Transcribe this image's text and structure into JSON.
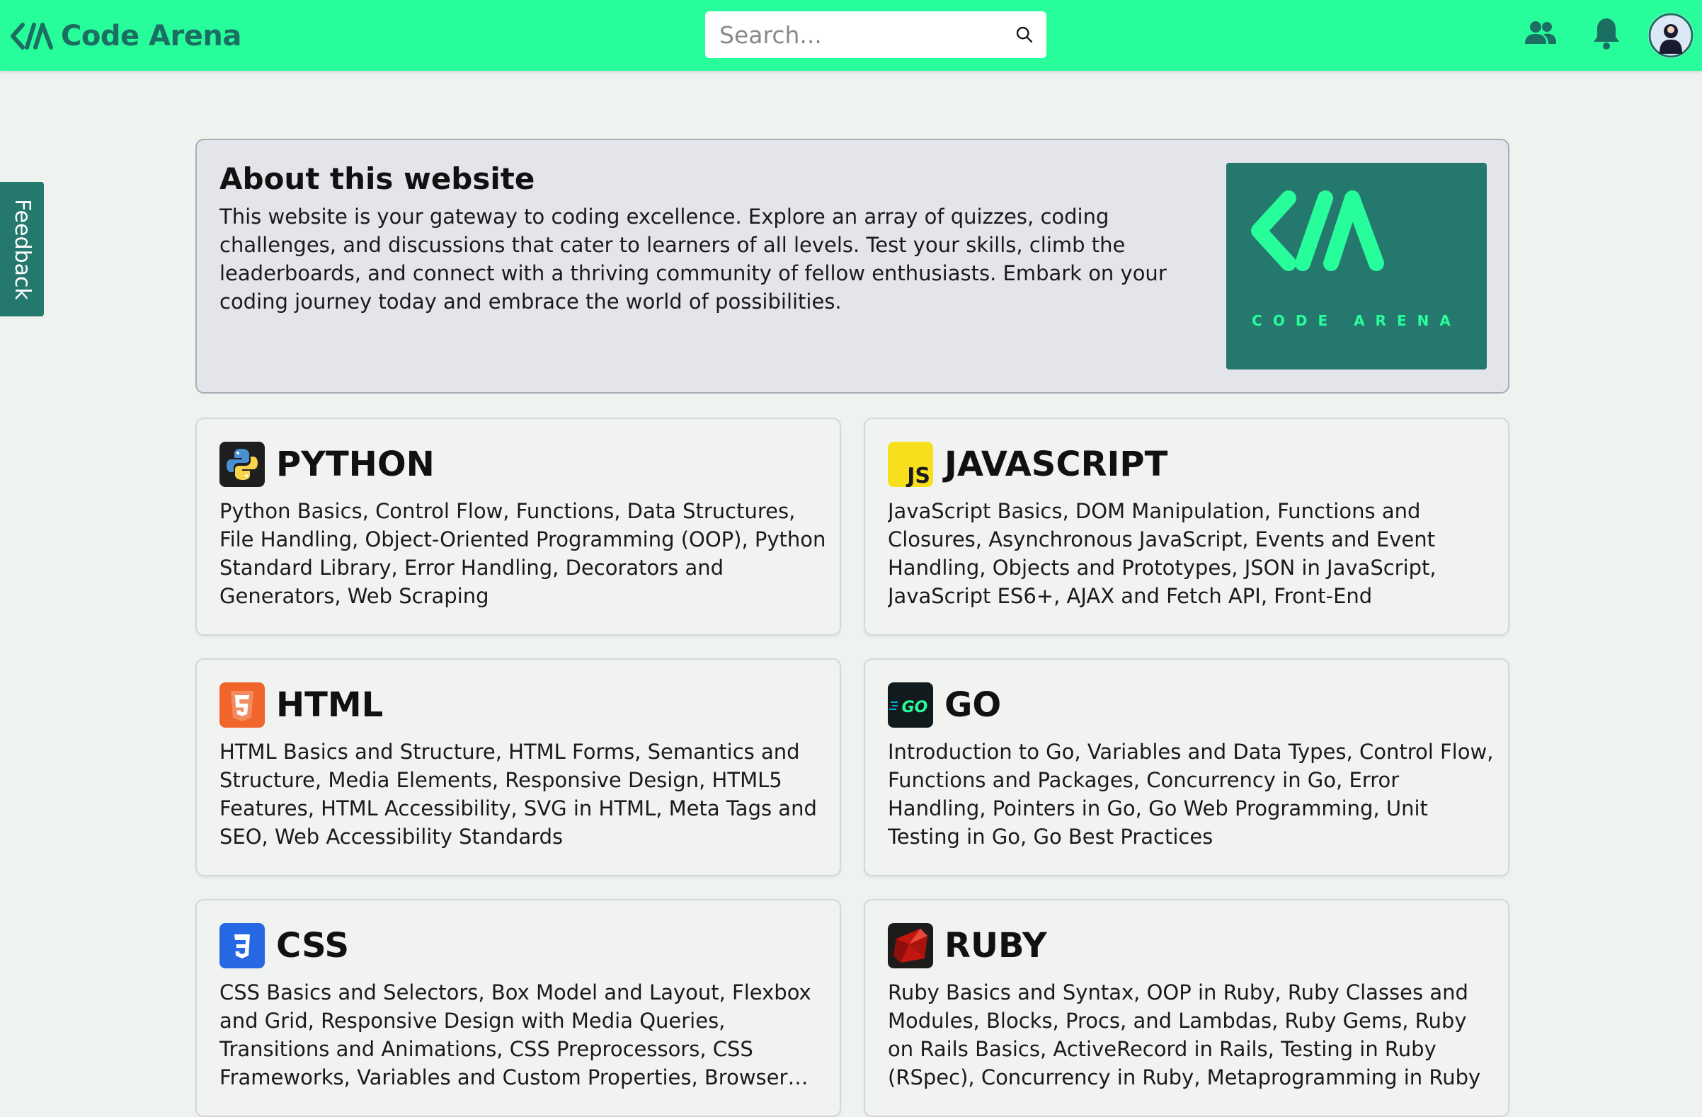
{
  "header": {
    "brand_name": "Code Arena",
    "search_placeholder": "Search..."
  },
  "feedback": {
    "label": "Feedback"
  },
  "about": {
    "title": "About this website",
    "text": "This website is your gateway to coding excellence. Explore an array of quizzes, coding challenges, and discussions that cater to learners of all levels. Test your skills, climb the leaderboards, and connect with a thriving community of fellow enthusiasts. Embark on your coding journey today and embrace the world of possibilities.",
    "logo_caption": "CODE ARENA"
  },
  "cards": [
    {
      "title": "PYTHON",
      "icon": "python-icon",
      "text": "Python Basics, Control Flow, Functions, Data Structures, File Handling, Object-Oriented Programming (OOP), Python Standard Library, Error Handling, Decorators and Generators, Web Scraping"
    },
    {
      "title": "JAVASCRIPT",
      "icon": "javascript-icon",
      "icon_text": "JS",
      "text": "JavaScript Basics, DOM Manipulation, Functions and Closures, Asynchronous JavaScript, Events and Event Handling, Objects and Prototypes, JSON in JavaScript, JavaScript ES6+, AJAX and Fetch API, Front-End Frameworks"
    },
    {
      "title": "HTML",
      "icon": "html5-icon",
      "text": "HTML Basics and Structure, HTML Forms, Semantics and Structure, Media Elements, Responsive Design, HTML5 Features, HTML Accessibility, SVG in HTML, Meta Tags and SEO, Web Accessibility Standards"
    },
    {
      "title": "GO",
      "icon": "go-icon",
      "icon_text": "GO",
      "text": "Introduction to Go, Variables and Data Types, Control Flow, Functions and Packages, Concurrency in Go, Error Handling, Pointers in Go, Go Web Programming, Unit Testing in Go, Go Best Practices"
    },
    {
      "title": "CSS",
      "icon": "css3-icon",
      "text": "CSS Basics and Selectors, Box Model and Layout, Flexbox and Grid, Responsive Design with Media Queries, Transitions and Animations, CSS Preprocessors, CSS Frameworks, Variables and Custom Properties, Browser Dev Tools, CSS..."
    },
    {
      "title": "RUBY",
      "icon": "ruby-icon",
      "text": "Ruby Basics and Syntax, OOP in Ruby, Ruby Classes and Modules, Blocks, Procs, and Lambdas, Ruby Gems, Ruby on Rails Basics, ActiveRecord in Rails, Testing in Ruby (RSpec), Concurrency in Ruby, Metaprogramming in Ruby"
    }
  ],
  "colors": {
    "accent": "#28fd9b",
    "brand_dark": "#25786d",
    "background": "#eff3f0"
  }
}
